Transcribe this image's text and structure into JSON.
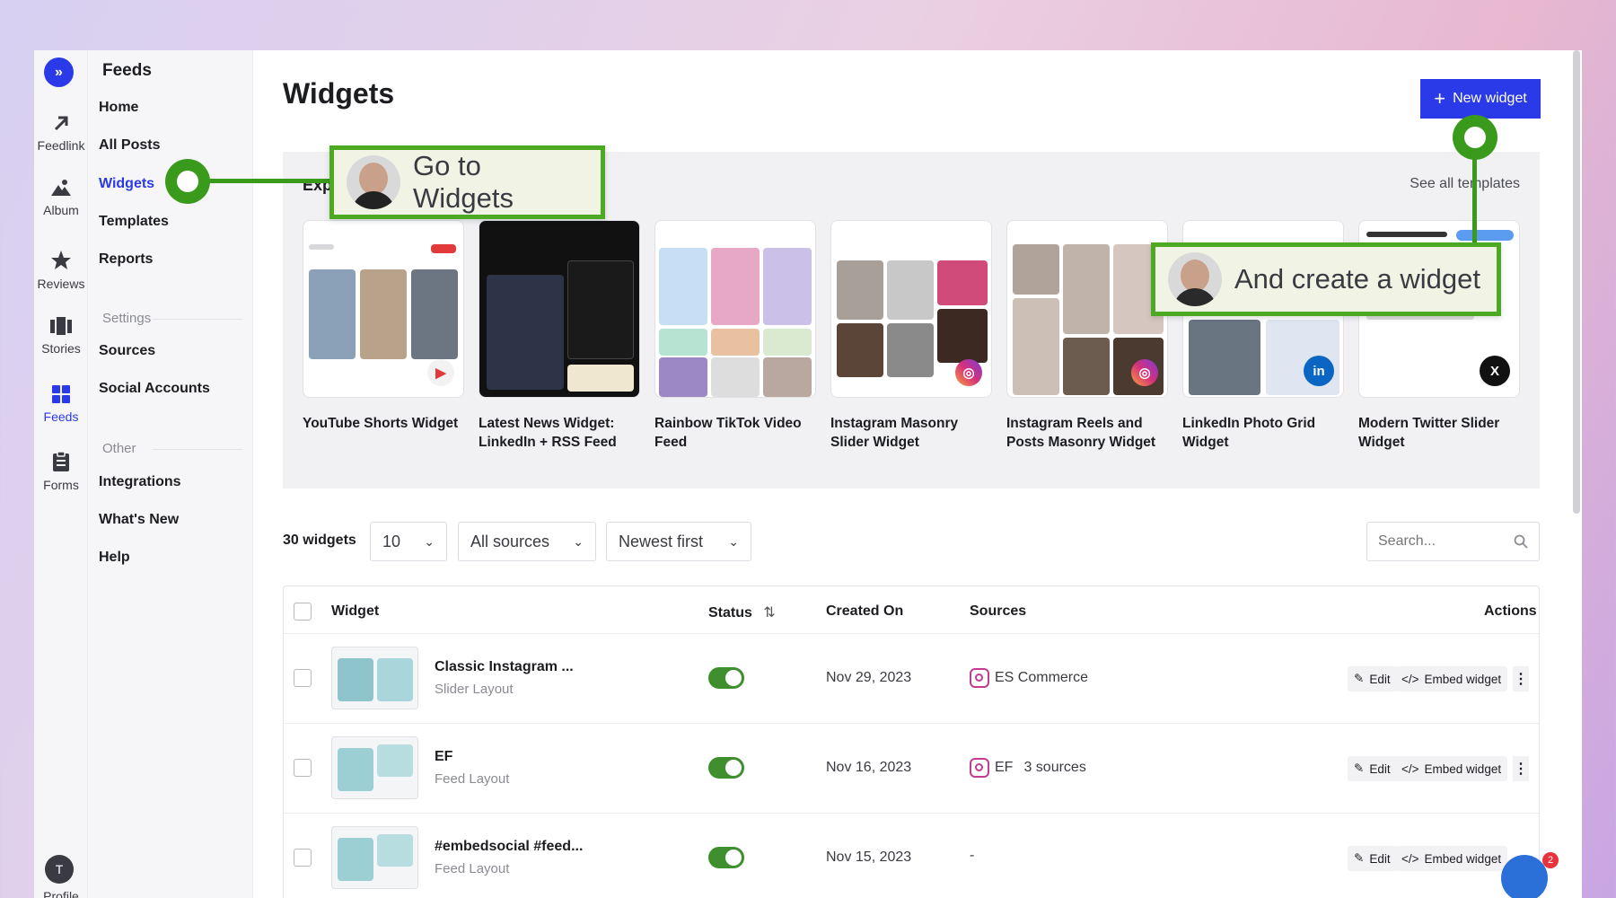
{
  "rail": {
    "logo": "»",
    "items": [
      {
        "label": "Feedlink",
        "icon": "arrow-up-right-icon"
      },
      {
        "label": "Album",
        "icon": "mountain-icon"
      },
      {
        "label": "Reviews",
        "icon": "star-icon"
      },
      {
        "label": "Stories",
        "icon": "stories-icon"
      },
      {
        "label": "Feeds",
        "icon": "grid-icon"
      },
      {
        "label": "Forms",
        "icon": "clipboard-icon"
      }
    ],
    "profile_initial": "T",
    "profile_label": "Profile"
  },
  "sidenav": {
    "title": "Feeds",
    "links": [
      "Home",
      "All Posts",
      "Widgets",
      "Templates",
      "Reports"
    ],
    "settings_label": "Settings",
    "settings_links": [
      "Sources",
      "Social Accounts"
    ],
    "other_label": "Other",
    "other_links": [
      "Integrations",
      "What's New",
      "Help"
    ]
  },
  "page": {
    "title": "Widgets",
    "new_widget_label": "New widget"
  },
  "templates": {
    "heading_visible": "Expl",
    "see_all": "See all templates",
    "cards": [
      {
        "caption": "YouTube Shorts Widget"
      },
      {
        "caption": "Latest News Widget: LinkedIn + RSS Feed"
      },
      {
        "caption": "Rainbow TikTok Video Feed"
      },
      {
        "caption": "Instagram Masonry Slider Widget"
      },
      {
        "caption": "Instagram Reels and Posts Masonry Widget"
      },
      {
        "caption": "LinkedIn Photo Grid Widget"
      },
      {
        "caption": "Modern Twitter Slider Widget"
      }
    ]
  },
  "filters": {
    "count": "30 widgets",
    "per_page": "10",
    "sources": "All sources",
    "sort": "Newest first",
    "search_placeholder": "Search..."
  },
  "table": {
    "headers": {
      "widget": "Widget",
      "status": "Status",
      "created": "Created On",
      "sources": "Sources",
      "actions": "Actions"
    },
    "edit_label": "Edit",
    "embed_label": "Embed widget",
    "rows": [
      {
        "name": "Classic Instagram ...",
        "layout": "Slider Layout",
        "enabled": true,
        "date": "Nov 29, 2023",
        "source": "ES Commerce",
        "extra": ""
      },
      {
        "name": "EF",
        "layout": "Feed Layout",
        "enabled": true,
        "date": "Nov 16, 2023",
        "source": "EF",
        "extra": "3 sources"
      },
      {
        "name": "#embedsocial #feed...",
        "layout": "Feed Layout",
        "enabled": true,
        "date": "Nov 15, 2023",
        "source": "-",
        "extra": ""
      }
    ]
  },
  "callouts": {
    "go_to_widgets": "Go to Widgets",
    "create_widget": "And create a widget"
  },
  "chat_badge": "2",
  "colors": {
    "accent": "#2b3ae8",
    "callout_green": "#4caa22",
    "toggle_on": "#3f8f2e"
  }
}
